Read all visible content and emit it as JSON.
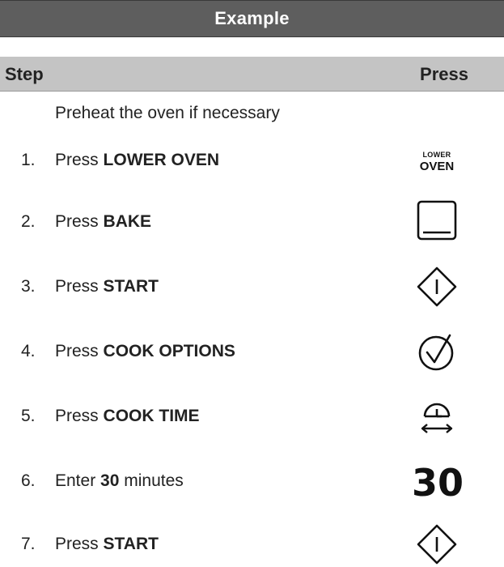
{
  "header": {
    "title": "Example"
  },
  "columns": {
    "step": "Step",
    "press": "Press"
  },
  "preheat": {
    "text": "Preheat the oven if necessary"
  },
  "steps": [
    {
      "num": "1.",
      "prefix": "Press",
      "bold": "LOWER OVEN",
      "suffix": "",
      "key": {
        "icon": "lower-oven-label",
        "line1": "LOWER",
        "line2": "OVEN"
      }
    },
    {
      "num": "2.",
      "prefix": "Press",
      "bold": "BAKE",
      "suffix": "",
      "key": {
        "icon": "bake-icon"
      }
    },
    {
      "num": "3.",
      "prefix": "Press",
      "bold": "START",
      "suffix": "",
      "key": {
        "icon": "start-icon"
      }
    },
    {
      "num": "4.",
      "prefix": "Press",
      "bold": "COOK OPTIONS",
      "suffix": "",
      "key": {
        "icon": "cook-options-icon"
      }
    },
    {
      "num": "5.",
      "prefix": "Press",
      "bold": "COOK TIME",
      "suffix": "",
      "key": {
        "icon": "cook-time-icon"
      }
    },
    {
      "num": "6.",
      "prefix": "Enter",
      "bold": "30",
      "suffix": "minutes",
      "key": {
        "icon": "number-display",
        "text": "30"
      }
    },
    {
      "num": "7.",
      "prefix": "Press",
      "bold": "START",
      "suffix": "",
      "key": {
        "icon": "start-icon"
      }
    }
  ]
}
